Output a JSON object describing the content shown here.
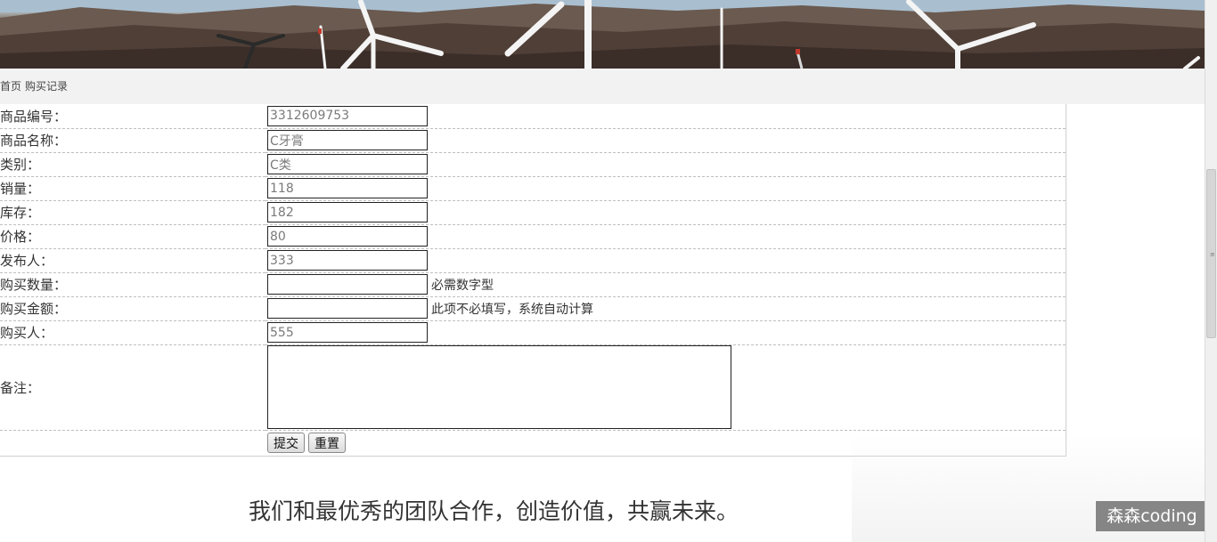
{
  "breadcrumb": {
    "home": "首页",
    "current": "购买记录"
  },
  "form": {
    "fields": [
      {
        "label": "商品编号：",
        "value": "3312609753"
      },
      {
        "label": "商品名称：",
        "value": "C牙膏"
      },
      {
        "label": "类别：",
        "value": "C类"
      },
      {
        "label": "销量：",
        "value": "118"
      },
      {
        "label": "库存：",
        "value": "182"
      },
      {
        "label": "价格：",
        "value": "80"
      },
      {
        "label": "发布人：",
        "value": "333"
      }
    ],
    "quantity": {
      "label": "购买数量：",
      "value": "",
      "hint": "必需数字型"
    },
    "amount": {
      "label": "购买金额：",
      "value": "",
      "hint": "此项不必填写，系统自动计算"
    },
    "buyer": {
      "label": "购买人：",
      "value": "555"
    },
    "notes": {
      "label": "备注：",
      "value": ""
    },
    "submit_label": "提交",
    "reset_label": "重置"
  },
  "footer": {
    "slogan": "我们和最优秀的团队合作，创造价值，共赢未来。"
  },
  "watermark": "森森coding"
}
